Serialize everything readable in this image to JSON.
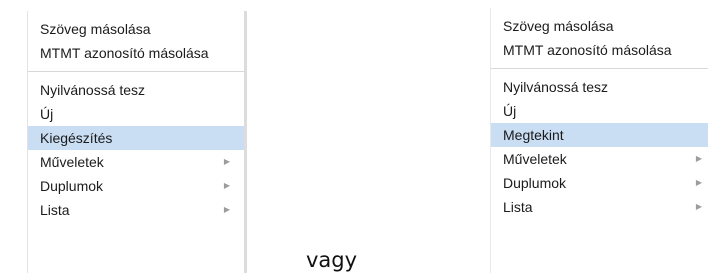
{
  "menus": [
    {
      "group1": [
        {
          "label": "Szöveg másolása"
        },
        {
          "label": "MTMT azonosító másolása"
        }
      ],
      "group2": [
        {
          "label": "Nyilvánossá tesz",
          "submenu": false
        },
        {
          "label": "Új",
          "submenu": false
        },
        {
          "label": "Kiegészítés",
          "submenu": false,
          "highlighted": true
        },
        {
          "label": "Műveletek",
          "submenu": true
        },
        {
          "label": "Duplumok",
          "submenu": true
        },
        {
          "label": "Lista",
          "submenu": true
        }
      ]
    },
    {
      "group1": [
        {
          "label": "Szöveg másolása"
        },
        {
          "label": "MTMT azonosító másolása"
        }
      ],
      "group2": [
        {
          "label": "Nyilvánossá tesz",
          "submenu": false
        },
        {
          "label": "Új",
          "submenu": false
        },
        {
          "label": "Megtekint",
          "submenu": false,
          "highlighted": true
        },
        {
          "label": "Műveletek",
          "submenu": true
        },
        {
          "label": "Duplumok",
          "submenu": true
        },
        {
          "label": "Lista",
          "submenu": true
        }
      ]
    }
  ],
  "connector_text": "vagy",
  "submenu_arrow_icon": "triangle-right-icon",
  "colors": {
    "highlight": "#c9ddf3",
    "separator": "#d8d8d8",
    "text": "#1b1b1b",
    "arrow": "#9c9c9c"
  }
}
